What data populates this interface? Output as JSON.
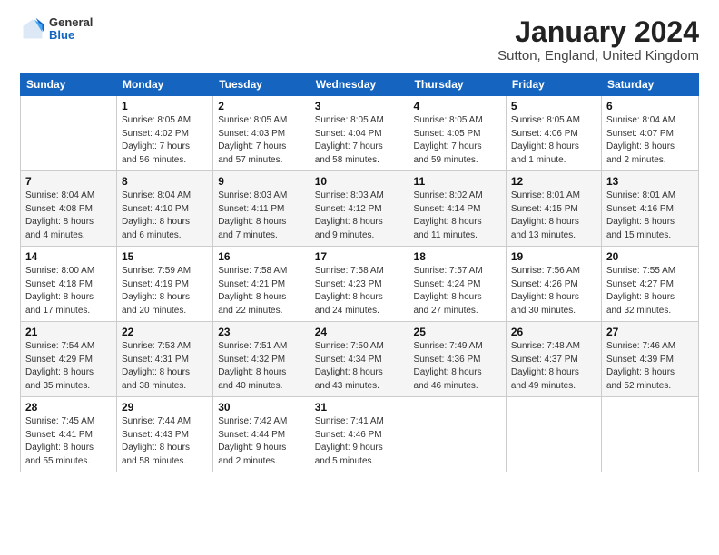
{
  "logo": {
    "general": "General",
    "blue": "Blue"
  },
  "title": "January 2024",
  "location": "Sutton, England, United Kingdom",
  "days_header": [
    "Sunday",
    "Monday",
    "Tuesday",
    "Wednesday",
    "Thursday",
    "Friday",
    "Saturday"
  ],
  "weeks": [
    [
      {
        "day": "",
        "info": ""
      },
      {
        "day": "1",
        "info": "Sunrise: 8:05 AM\nSunset: 4:02 PM\nDaylight: 7 hours\nand 56 minutes."
      },
      {
        "day": "2",
        "info": "Sunrise: 8:05 AM\nSunset: 4:03 PM\nDaylight: 7 hours\nand 57 minutes."
      },
      {
        "day": "3",
        "info": "Sunrise: 8:05 AM\nSunset: 4:04 PM\nDaylight: 7 hours\nand 58 minutes."
      },
      {
        "day": "4",
        "info": "Sunrise: 8:05 AM\nSunset: 4:05 PM\nDaylight: 7 hours\nand 59 minutes."
      },
      {
        "day": "5",
        "info": "Sunrise: 8:05 AM\nSunset: 4:06 PM\nDaylight: 8 hours\nand 1 minute."
      },
      {
        "day": "6",
        "info": "Sunrise: 8:04 AM\nSunset: 4:07 PM\nDaylight: 8 hours\nand 2 minutes."
      }
    ],
    [
      {
        "day": "7",
        "info": "Sunrise: 8:04 AM\nSunset: 4:08 PM\nDaylight: 8 hours\nand 4 minutes."
      },
      {
        "day": "8",
        "info": "Sunrise: 8:04 AM\nSunset: 4:10 PM\nDaylight: 8 hours\nand 6 minutes."
      },
      {
        "day": "9",
        "info": "Sunrise: 8:03 AM\nSunset: 4:11 PM\nDaylight: 8 hours\nand 7 minutes."
      },
      {
        "day": "10",
        "info": "Sunrise: 8:03 AM\nSunset: 4:12 PM\nDaylight: 8 hours\nand 9 minutes."
      },
      {
        "day": "11",
        "info": "Sunrise: 8:02 AM\nSunset: 4:14 PM\nDaylight: 8 hours\nand 11 minutes."
      },
      {
        "day": "12",
        "info": "Sunrise: 8:01 AM\nSunset: 4:15 PM\nDaylight: 8 hours\nand 13 minutes."
      },
      {
        "day": "13",
        "info": "Sunrise: 8:01 AM\nSunset: 4:16 PM\nDaylight: 8 hours\nand 15 minutes."
      }
    ],
    [
      {
        "day": "14",
        "info": "Sunrise: 8:00 AM\nSunset: 4:18 PM\nDaylight: 8 hours\nand 17 minutes."
      },
      {
        "day": "15",
        "info": "Sunrise: 7:59 AM\nSunset: 4:19 PM\nDaylight: 8 hours\nand 20 minutes."
      },
      {
        "day": "16",
        "info": "Sunrise: 7:58 AM\nSunset: 4:21 PM\nDaylight: 8 hours\nand 22 minutes."
      },
      {
        "day": "17",
        "info": "Sunrise: 7:58 AM\nSunset: 4:23 PM\nDaylight: 8 hours\nand 24 minutes."
      },
      {
        "day": "18",
        "info": "Sunrise: 7:57 AM\nSunset: 4:24 PM\nDaylight: 8 hours\nand 27 minutes."
      },
      {
        "day": "19",
        "info": "Sunrise: 7:56 AM\nSunset: 4:26 PM\nDaylight: 8 hours\nand 30 minutes."
      },
      {
        "day": "20",
        "info": "Sunrise: 7:55 AM\nSunset: 4:27 PM\nDaylight: 8 hours\nand 32 minutes."
      }
    ],
    [
      {
        "day": "21",
        "info": "Sunrise: 7:54 AM\nSunset: 4:29 PM\nDaylight: 8 hours\nand 35 minutes."
      },
      {
        "day": "22",
        "info": "Sunrise: 7:53 AM\nSunset: 4:31 PM\nDaylight: 8 hours\nand 38 minutes."
      },
      {
        "day": "23",
        "info": "Sunrise: 7:51 AM\nSunset: 4:32 PM\nDaylight: 8 hours\nand 40 minutes."
      },
      {
        "day": "24",
        "info": "Sunrise: 7:50 AM\nSunset: 4:34 PM\nDaylight: 8 hours\nand 43 minutes."
      },
      {
        "day": "25",
        "info": "Sunrise: 7:49 AM\nSunset: 4:36 PM\nDaylight: 8 hours\nand 46 minutes."
      },
      {
        "day": "26",
        "info": "Sunrise: 7:48 AM\nSunset: 4:37 PM\nDaylight: 8 hours\nand 49 minutes."
      },
      {
        "day": "27",
        "info": "Sunrise: 7:46 AM\nSunset: 4:39 PM\nDaylight: 8 hours\nand 52 minutes."
      }
    ],
    [
      {
        "day": "28",
        "info": "Sunrise: 7:45 AM\nSunset: 4:41 PM\nDaylight: 8 hours\nand 55 minutes."
      },
      {
        "day": "29",
        "info": "Sunrise: 7:44 AM\nSunset: 4:43 PM\nDaylight: 8 hours\nand 58 minutes."
      },
      {
        "day": "30",
        "info": "Sunrise: 7:42 AM\nSunset: 4:44 PM\nDaylight: 9 hours\nand 2 minutes."
      },
      {
        "day": "31",
        "info": "Sunrise: 7:41 AM\nSunset: 4:46 PM\nDaylight: 9 hours\nand 5 minutes."
      },
      {
        "day": "",
        "info": ""
      },
      {
        "day": "",
        "info": ""
      },
      {
        "day": "",
        "info": ""
      }
    ]
  ]
}
